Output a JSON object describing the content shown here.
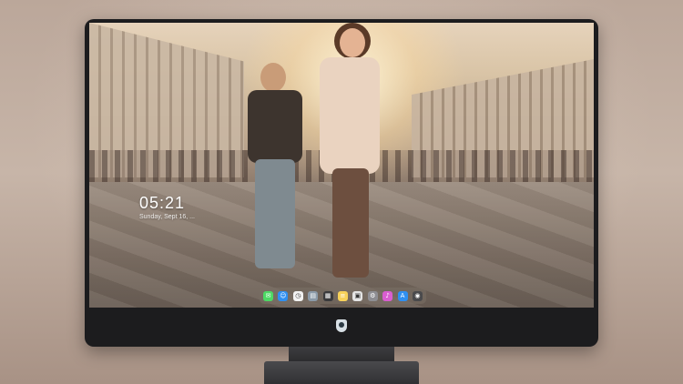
{
  "lockscreen": {
    "time": "05:21",
    "date": "Sunday, Sept 16, ..."
  },
  "dock": {
    "items": [
      {
        "name": "messages-icon",
        "color": "#4cd964",
        "glyph": "✉"
      },
      {
        "name": "finder-icon",
        "color": "#2f8ff0",
        "glyph": "☺"
      },
      {
        "name": "clock-icon",
        "color": "#f2f2f2",
        "glyph": "◷"
      },
      {
        "name": "preview-icon",
        "color": "#8b9aa8",
        "glyph": "▤"
      },
      {
        "name": "launchpad-icon",
        "color": "#3a3a3c",
        "glyph": "▦"
      },
      {
        "name": "notes-icon",
        "color": "#f7d25a",
        "glyph": "≡"
      },
      {
        "name": "photos-icon",
        "color": "#e5e5e5",
        "glyph": "▣"
      },
      {
        "name": "settings-icon",
        "color": "#8e8e93",
        "glyph": "⚙"
      },
      {
        "name": "itunes-icon",
        "color": "#d95ed0",
        "glyph": "♪"
      },
      {
        "name": "appstore-icon",
        "color": "#2f8ff0",
        "glyph": "A"
      },
      {
        "name": "camera-icon",
        "color": "#4a4a4c",
        "glyph": "◉"
      }
    ]
  },
  "colors": {
    "bezel": "#1c1c1e",
    "dock_background": "rgba(120,110,100,0.6)"
  }
}
